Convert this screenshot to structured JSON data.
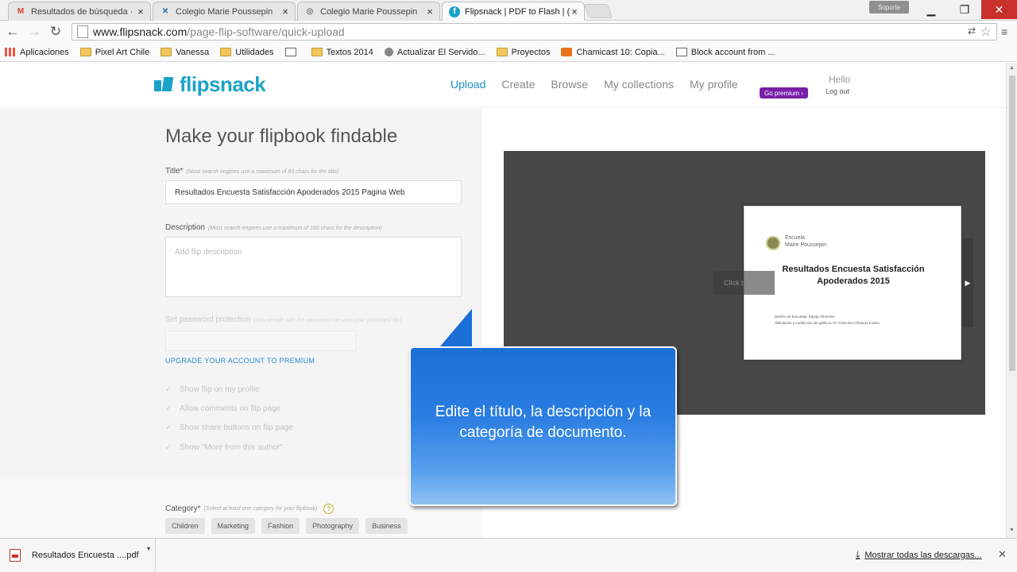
{
  "browser": {
    "tabs": [
      {
        "title": "Resultados de búsqueda ·",
        "icon": "gmail-icon",
        "active": false
      },
      {
        "title": "Colegio Marie Poussepin",
        "icon": "site-icon",
        "active": false
      },
      {
        "title": "Colegio Marie Poussepin",
        "icon": "globe-icon",
        "active": false
      },
      {
        "title": "Flipsnack | PDF to Flash | (",
        "icon": "flipsnack-icon",
        "active": true
      }
    ],
    "profile_label": "Soporte",
    "url_host": "www.flipsnack.com",
    "url_path": "/page-flip-software/quick-upload",
    "bookmarks": [
      {
        "label": "Aplicaciones",
        "icon": "apps-grid-icon"
      },
      {
        "label": "Pixel Art Chile",
        "icon": "folder-icon"
      },
      {
        "label": "Vanessa",
        "icon": "folder-icon"
      },
      {
        "label": "Utilidades",
        "icon": "folder-icon"
      },
      {
        "label": "",
        "icon": "print-icon"
      },
      {
        "label": "Textos 2014",
        "icon": "folder-icon"
      },
      {
        "label": "Actualizar El Servido...",
        "icon": "server-icon"
      },
      {
        "label": "Proyectos",
        "icon": "folder-icon"
      },
      {
        "label": "Chamicast 10: Copia...",
        "icon": "video-icon"
      },
      {
        "label": "Block account from ...",
        "icon": "document-icon"
      }
    ]
  },
  "site": {
    "logo_text": "flipsnack",
    "nav": [
      {
        "label": "Upload",
        "active": true
      },
      {
        "label": "Create",
        "active": false
      },
      {
        "label": "Browse",
        "active": false
      },
      {
        "label": "My collections",
        "active": false
      },
      {
        "label": "My profile",
        "active": false
      }
    ],
    "premium_label": "Go premium ›",
    "hello": "Hello",
    "logout": "Log out",
    "brand_color": "#1ba3c9"
  },
  "form": {
    "heading": "Make your flipbook findable",
    "title_label": "Title*",
    "title_hint": "(Most search engines use a maximum of 60 chars for the title)",
    "title_value": "Resultados Encuesta Satisfacción Apoderados 2015 Pagina Web",
    "description_label": "Description",
    "description_hint": "(Most search engines use a maximum of 160 chars for the description)",
    "description_placeholder": "Add flip description",
    "password_label": "Set password protection",
    "password_hint": "(only people with the password can view your published flip)",
    "upgrade_link": "UPGRADE YOUR ACCOUNT TO PREMIUM",
    "options": [
      "Show flip on my profile",
      "Allow comments on flip page",
      "Show share buttons on flip page",
      "Show \"More from this author\""
    ],
    "category_label": "Category*",
    "category_hint": "(Select at least one category for your flipbook)",
    "categories": [
      "Children",
      "Marketing",
      "Fashion",
      "Photography",
      "Business"
    ]
  },
  "preview": {
    "school_line1": "Escuela",
    "school_line2": "Marie Poussepin",
    "doc_title": "Resultados Encuesta Satisfacción Apoderados 2015",
    "credits_line1": "Diseño de Encuesta: Equipo Directivo",
    "credits_line2": "Tabulación y confección de gráficos: Pr. Francisco Oliveros Castro",
    "click_to_read": "Click to read"
  },
  "callout": {
    "text": "Edite el título, la descripción y la categoría de documento."
  },
  "downloads": {
    "file_name": "Resultados Encuesta ....pdf",
    "show_all": "Mostrar todas las descargas..."
  }
}
